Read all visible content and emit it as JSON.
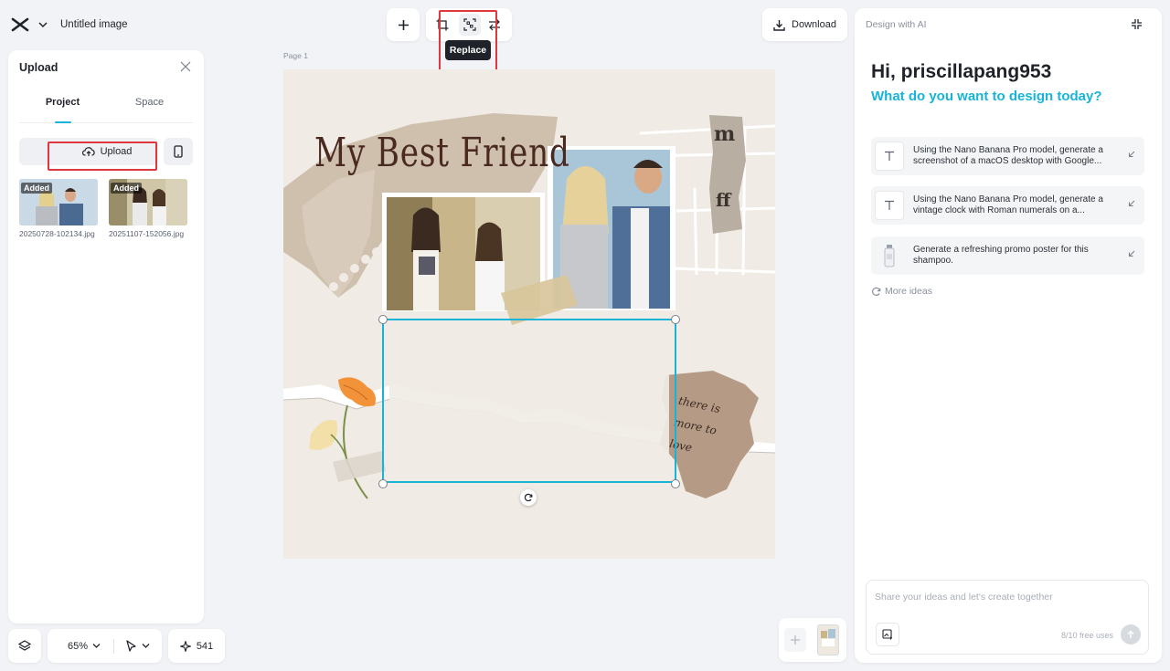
{
  "header": {
    "doc_title": "Untitled image"
  },
  "upload_panel": {
    "title": "Upload",
    "tabs": [
      {
        "label": "Project",
        "active": true
      },
      {
        "label": "Space",
        "active": false
      }
    ],
    "upload_button": "Upload",
    "files": [
      {
        "name": "20250728-102134.jpg",
        "badge": "Added"
      },
      {
        "name": "20251107-152056.jpg",
        "badge": "Added"
      }
    ]
  },
  "bottom_bar": {
    "zoom": "65%",
    "credits": "541"
  },
  "toolbar": {
    "tooltip": "Replace",
    "download_label": "Download"
  },
  "canvas": {
    "page_label": "Page 1",
    "heading": "My Best Friend",
    "script_lines": [
      "there is",
      "more to",
      "love"
    ]
  },
  "ai_panel": {
    "title": "Design with AI",
    "greeting": "Hi, priscillapang953",
    "subtitle": "What do you want to design today?",
    "suggestions": [
      {
        "text": "Using the Nano Banana Pro model, generate a screenshot of a macOS desktop with Google...",
        "icon": "text-icon"
      },
      {
        "text": "Using the Nano Banana Pro model, generate a vintage clock with Roman numerals on a...",
        "icon": "text-icon"
      },
      {
        "text": "Generate a refreshing promo poster for this shampoo.",
        "icon": "product-thumbnail"
      }
    ],
    "more_ideas": "More ideas",
    "chat_placeholder": "Share your ideas and let's create together",
    "free_uses": "8/10 free uses"
  },
  "colors": {
    "accent": "#18b4d8",
    "highlight": "#e0373f"
  }
}
